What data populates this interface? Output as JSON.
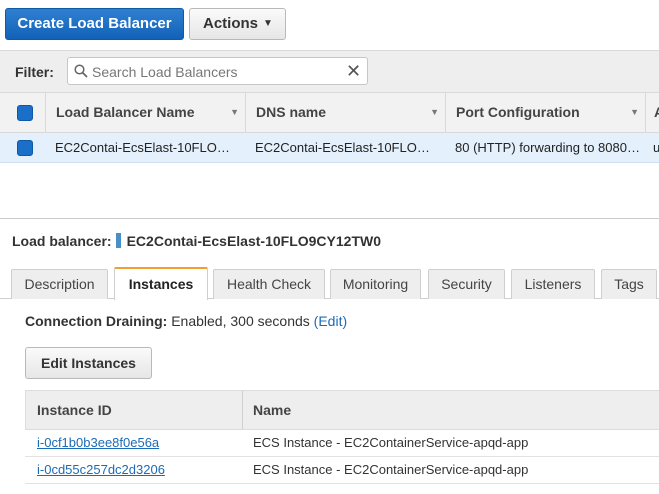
{
  "toolbar": {
    "create_label": "Create Load Balancer",
    "actions_label": "Actions"
  },
  "filter": {
    "label": "Filter:",
    "placeholder": "Search Load Balancers"
  },
  "grid": {
    "columns": [
      "Load Balancer Name",
      "DNS name",
      "Port Configuration",
      "A"
    ],
    "rows": [
      {
        "name": "EC2Contai-EcsElast-10FLO…",
        "dns": "EC2Contai-EcsElast-10FLO…",
        "port": "80 (HTTP) forwarding to 8080…",
        "extra": "u"
      }
    ]
  },
  "detail": {
    "label": "Load balancer:",
    "name": "EC2Contai-EcsElast-10FLO9CY12TW0"
  },
  "tabs": [
    "Description",
    "Instances",
    "Health Check",
    "Monitoring",
    "Security",
    "Listeners",
    "Tags"
  ],
  "active_tab": "Instances",
  "instances": {
    "draining_label": "Connection Draining:",
    "draining_value": "Enabled, 300 seconds",
    "edit_link": "(Edit)",
    "edit_button": "Edit Instances",
    "columns": [
      "Instance ID",
      "Name"
    ],
    "rows": [
      {
        "id": "i-0cf1b0b3ee8f0e56a",
        "name": "ECS Instance - EC2ContainerService-apqd-app"
      },
      {
        "id": "i-0cd55c257dc2d3206",
        "name": "ECS Instance - EC2ContainerService-apqd-app"
      }
    ]
  },
  "colors": {
    "primary": "#1166bb",
    "active_tab_accent": "#f0a030",
    "link": "#1c6bb6",
    "selected_row": "#e4f0fb"
  }
}
